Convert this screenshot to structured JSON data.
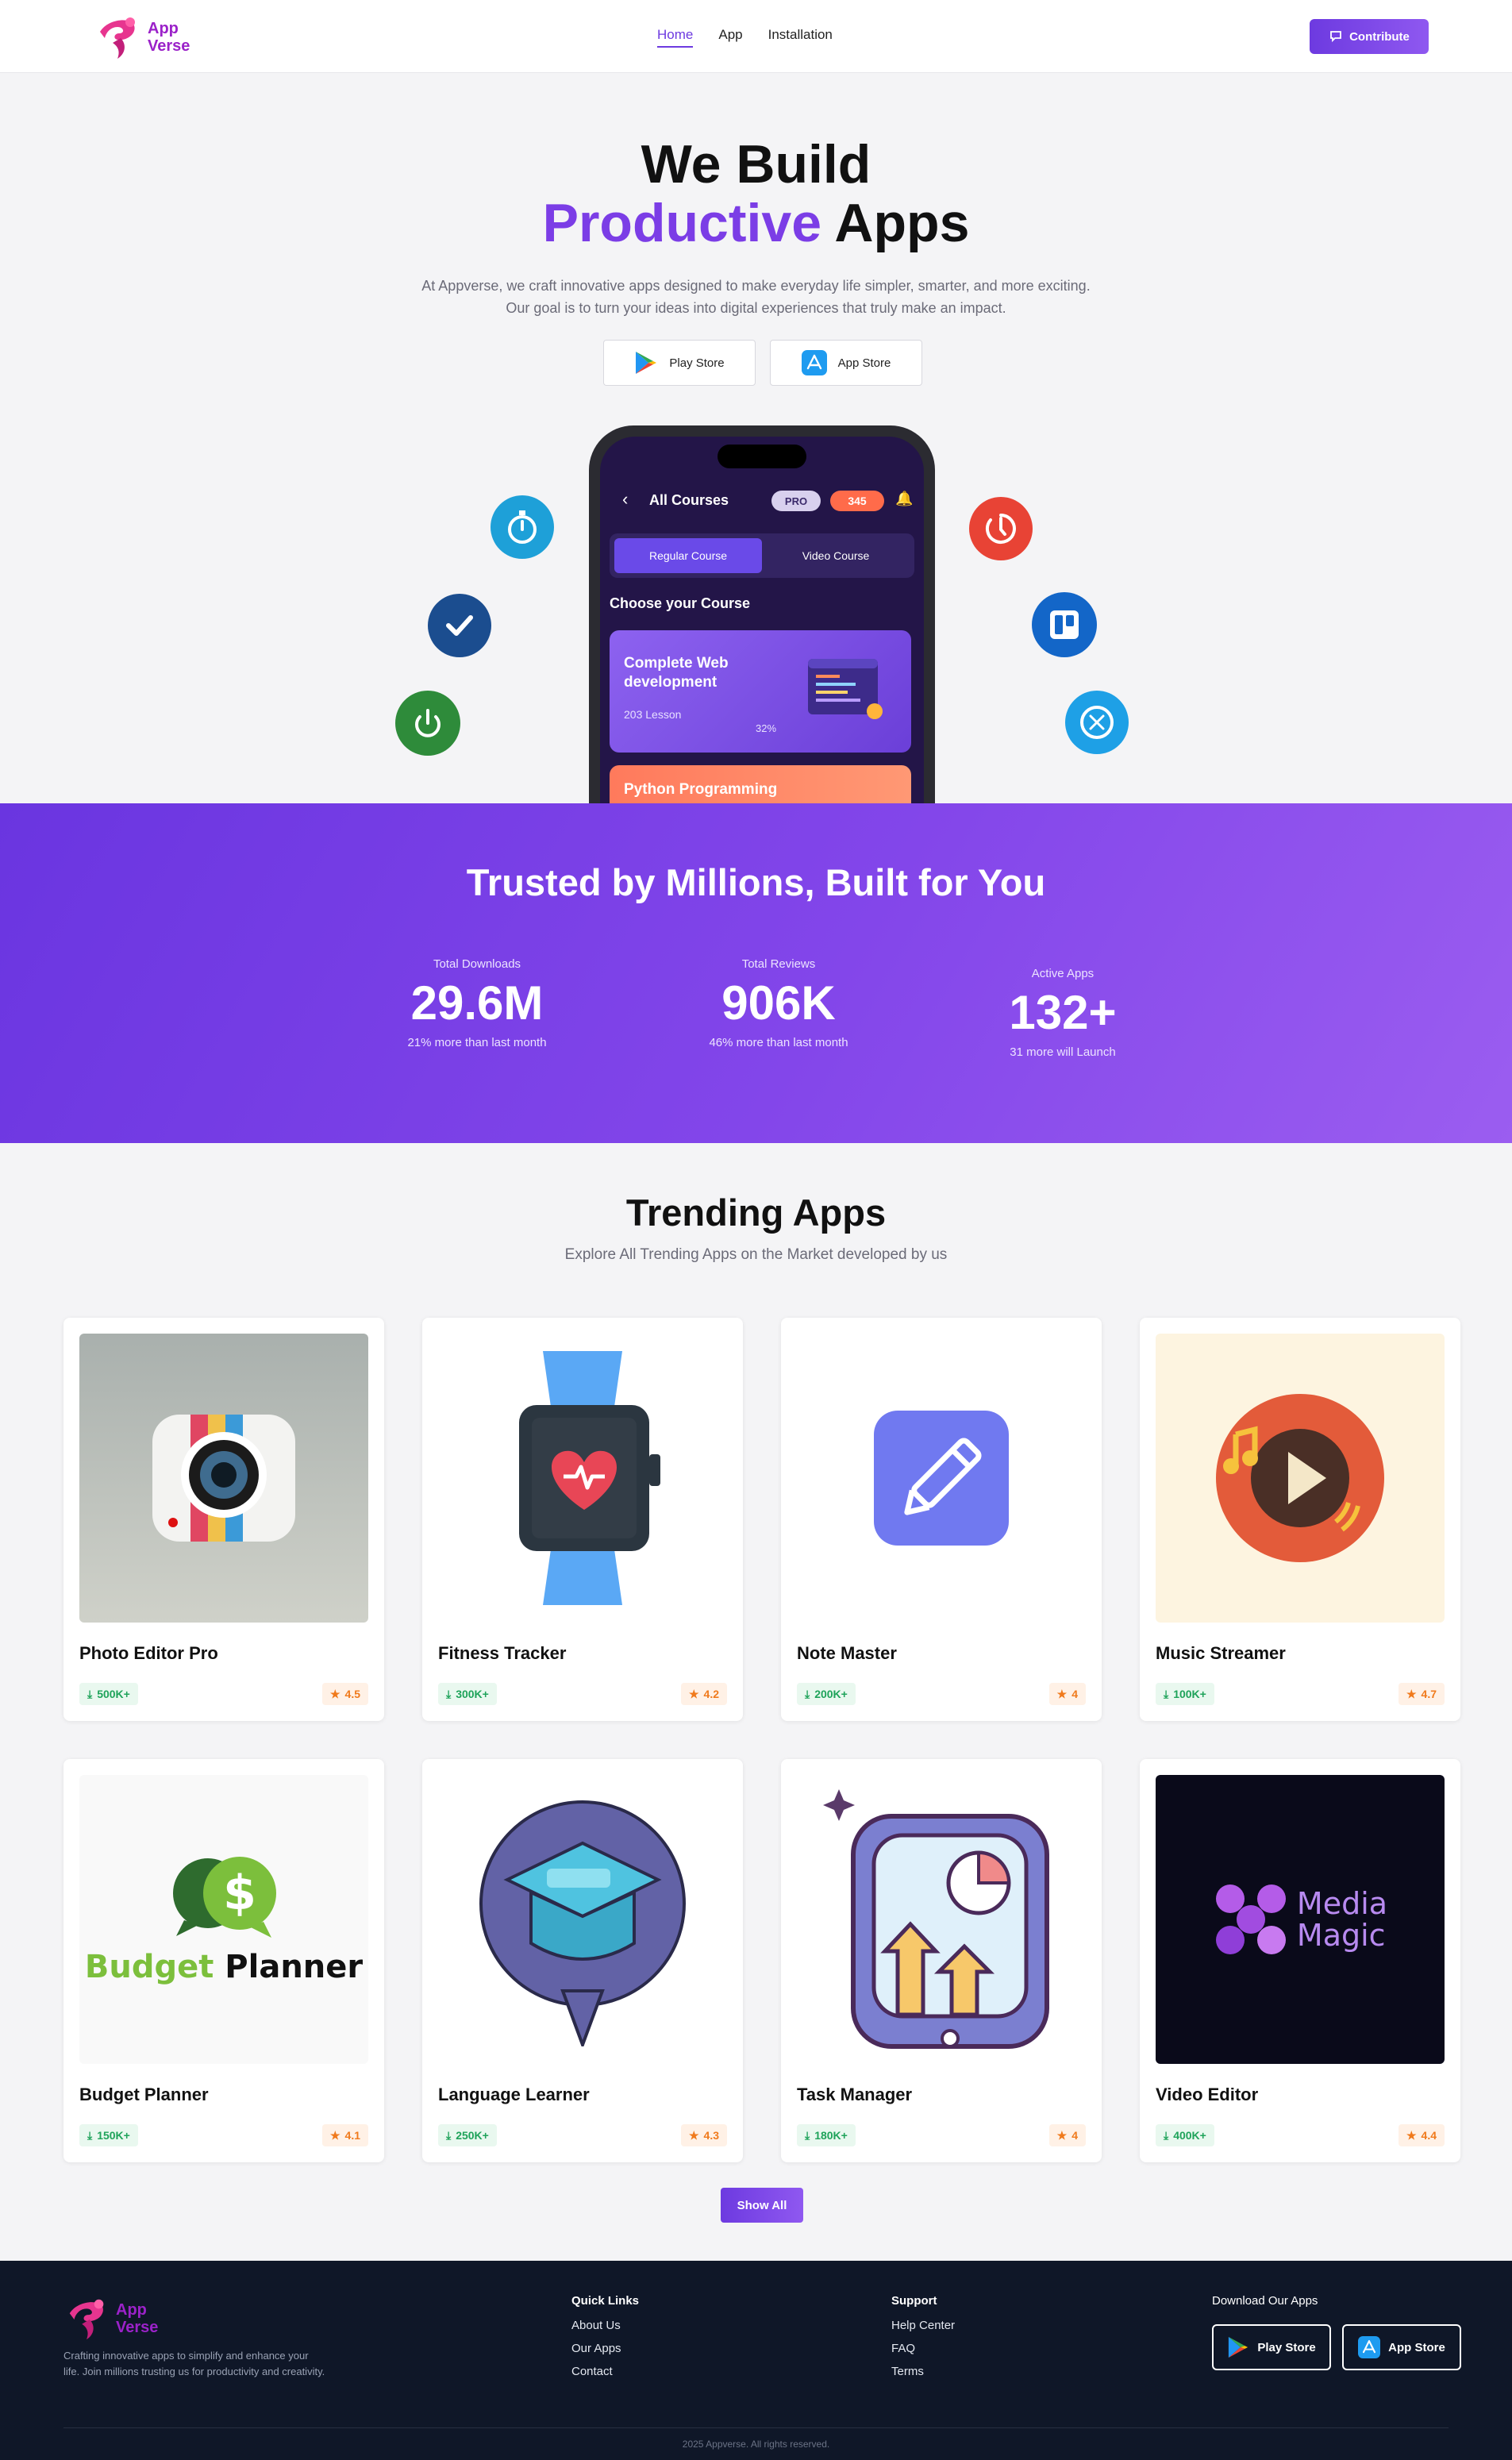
{
  "nav": {
    "logo": {
      "line1": "App",
      "line2": "Verse"
    },
    "links": [
      {
        "label": "Home",
        "active": true
      },
      {
        "label": "App",
        "active": false
      },
      {
        "label": "Installation",
        "active": false
      }
    ],
    "contribute_label": "Contribute",
    "accent_color": "#6d3ae0"
  },
  "hero": {
    "title_line1": "We Build",
    "title_accent": "Productive",
    "title_rest": "Apps",
    "desc_line1": "At Appverse, we craft innovative apps designed to make everyday life simpler, smarter, and more exciting.",
    "desc_line2": "Our goal is to turn your ideas into digital experiences that truly make an impact.",
    "play_label": "Play Store",
    "appstore_label": "App Store"
  },
  "phone": {
    "title": "All Courses",
    "pro_label": "PRO",
    "coins": "345",
    "tab_regular": "Regular Course",
    "tab_video": "Video Course",
    "choose": "Choose your Course",
    "course1_title": "Complete Web development",
    "course1_lessons": "203 Lesson",
    "course1_progress": "32%",
    "course2_title": "Python Programming"
  },
  "trusted": {
    "title": "Trusted by Millions, Built for You",
    "stats": [
      {
        "label": "Total Downloads",
        "value": "29.6M",
        "sub": "21% more than last month"
      },
      {
        "label": "Total Reviews",
        "value": "906K",
        "sub": "46% more than last month"
      },
      {
        "label": "Active Apps",
        "value": "132+",
        "sub": "31 more will Launch"
      }
    ]
  },
  "trending": {
    "title": "Trending Apps",
    "subtitle": "Explore All Trending Apps on the Market developed by us",
    "apps": [
      {
        "name": "Photo Editor Pro",
        "downloads": "500K+",
        "rating": "4.5"
      },
      {
        "name": "Fitness Tracker",
        "downloads": "300K+",
        "rating": "4.2"
      },
      {
        "name": "Note Master",
        "downloads": "200K+",
        "rating": "4"
      },
      {
        "name": "Music Streamer",
        "downloads": "100K+",
        "rating": "4.7"
      },
      {
        "name": "Budget Planner",
        "downloads": "150K+",
        "rating": "4.1"
      },
      {
        "name": "Language Learner",
        "downloads": "250K+",
        "rating": "4.3"
      },
      {
        "name": "Task Manager",
        "downloads": "180K+",
        "rating": "4"
      },
      {
        "name": "Video Editor",
        "downloads": "400K+",
        "rating": "4.4"
      }
    ],
    "budget_logo_word1": "Budget",
    "budget_logo_word2": "Planner",
    "media_logo_line1": "Media",
    "media_logo_line2": "Magic",
    "show_all": "Show All"
  },
  "footer": {
    "logo": {
      "line1": "App",
      "line2": "Verse"
    },
    "desc": "Crafting innovative apps to simplify and enhance your life. Join millions trusting us for productivity and creativity.",
    "quick_links": {
      "heading": "Quick Links",
      "items": [
        "About Us",
        "Our Apps",
        "Contact"
      ]
    },
    "support": {
      "heading": "Support",
      "items": [
        "Help Center",
        "FAQ",
        "Terms"
      ]
    },
    "download": {
      "heading": "Download Our Apps",
      "play": "Play Store",
      "appstore": "App Store"
    },
    "copyright": "2025 Appverse. All rights reserved."
  }
}
